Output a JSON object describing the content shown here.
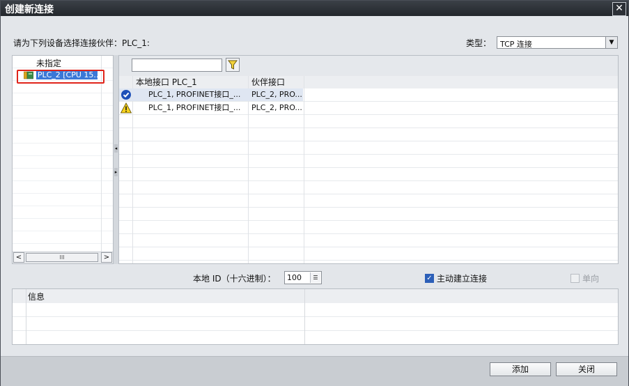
{
  "window": {
    "title": "创建新连接",
    "close_glyph": "✕"
  },
  "prompt": "请为下列设备选择连接伙伴：PLC_1:",
  "type": {
    "label": "类型：",
    "value": "TCP 连接"
  },
  "tree": {
    "items": [
      {
        "label": "未指定"
      },
      {
        "label": "PLC_2 [CPU 15..."
      }
    ],
    "scroll_thumb_glyph": "III"
  },
  "grid": {
    "columns": [
      "本地接口 PLC_1",
      "伙伴接口"
    ],
    "rows": [
      {
        "status": "ok",
        "local": "PLC_1, PROFINET接口_...",
        "partner": "PLC_2, PRO..."
      },
      {
        "status": "warning",
        "local": "PLC_1, PROFINET接口_...",
        "partner": "PLC_2, PRO..."
      }
    ]
  },
  "options": {
    "local_id_label": "本地 ID（十六进制）：",
    "local_id_value": "100",
    "active_connection_label": "主动建立连接",
    "active_connection_checked": true,
    "one_way_label": "单向",
    "one_way_checked": false
  },
  "info": {
    "header": "信息"
  },
  "buttons": {
    "add": "添加",
    "close": "关闭"
  },
  "colors": {
    "accent": "#3a78d8",
    "highlight": "#e0241a"
  }
}
